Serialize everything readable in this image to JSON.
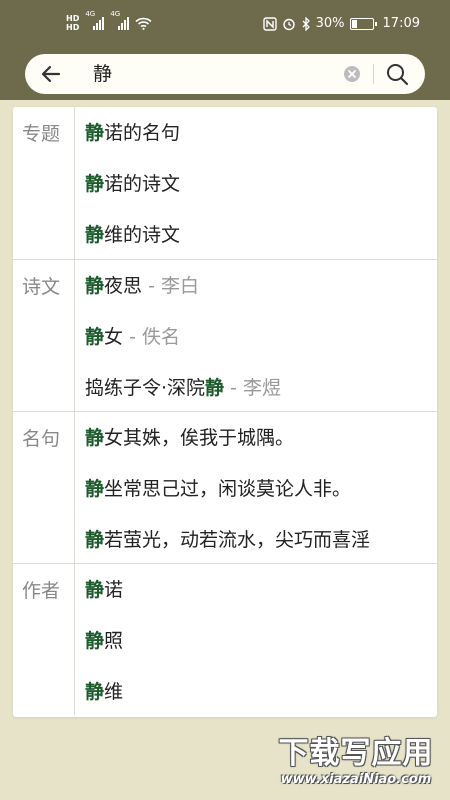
{
  "status_bar": {
    "hd_top": "HD",
    "hd_bottom": "HD",
    "network1": "4G",
    "network2": "4G",
    "battery_text": "30%",
    "time": "17:09",
    "battery_level": 0.3
  },
  "search": {
    "query": "静"
  },
  "sections": [
    {
      "label": "专题",
      "rows": [
        {
          "pre": "",
          "hl": "静",
          "post": "诺的名句",
          "author": ""
        },
        {
          "pre": "",
          "hl": "静",
          "post": "诺的诗文",
          "author": ""
        },
        {
          "pre": "",
          "hl": "静",
          "post": "维的诗文",
          "author": ""
        }
      ]
    },
    {
      "label": "诗文",
      "rows": [
        {
          "pre": "",
          "hl": "静",
          "post": "夜思",
          "author": " - 李白"
        },
        {
          "pre": "",
          "hl": "静",
          "post": "女",
          "author": " - 佚名"
        },
        {
          "pre": "捣练子令·深院",
          "hl": "静",
          "post": "",
          "author": " - 李煜"
        }
      ]
    },
    {
      "label": "名句",
      "rows": [
        {
          "pre": "",
          "hl": "静",
          "post": "女其姝，俟我于城隅。",
          "author": ""
        },
        {
          "pre": "",
          "hl": "静",
          "post": "坐常思己过，闲谈莫论人非。",
          "author": ""
        },
        {
          "pre": "",
          "hl": "静",
          "post": "若萤光，动若流水，尖巧而喜淫",
          "author": ""
        }
      ]
    },
    {
      "label": "作者",
      "rows": [
        {
          "pre": "",
          "hl": "静",
          "post": "诺",
          "author": ""
        },
        {
          "pre": "",
          "hl": "静",
          "post": "照",
          "author": ""
        },
        {
          "pre": "",
          "hl": "静",
          "post": "维",
          "author": ""
        }
      ]
    }
  ],
  "watermark": {
    "main": "下载写应用",
    "url": "www.xiazaiNiao.com"
  },
  "colors": {
    "topbar": "#6e6b4c",
    "background": "#e6e3c8",
    "highlight": "#1c5b2c"
  }
}
